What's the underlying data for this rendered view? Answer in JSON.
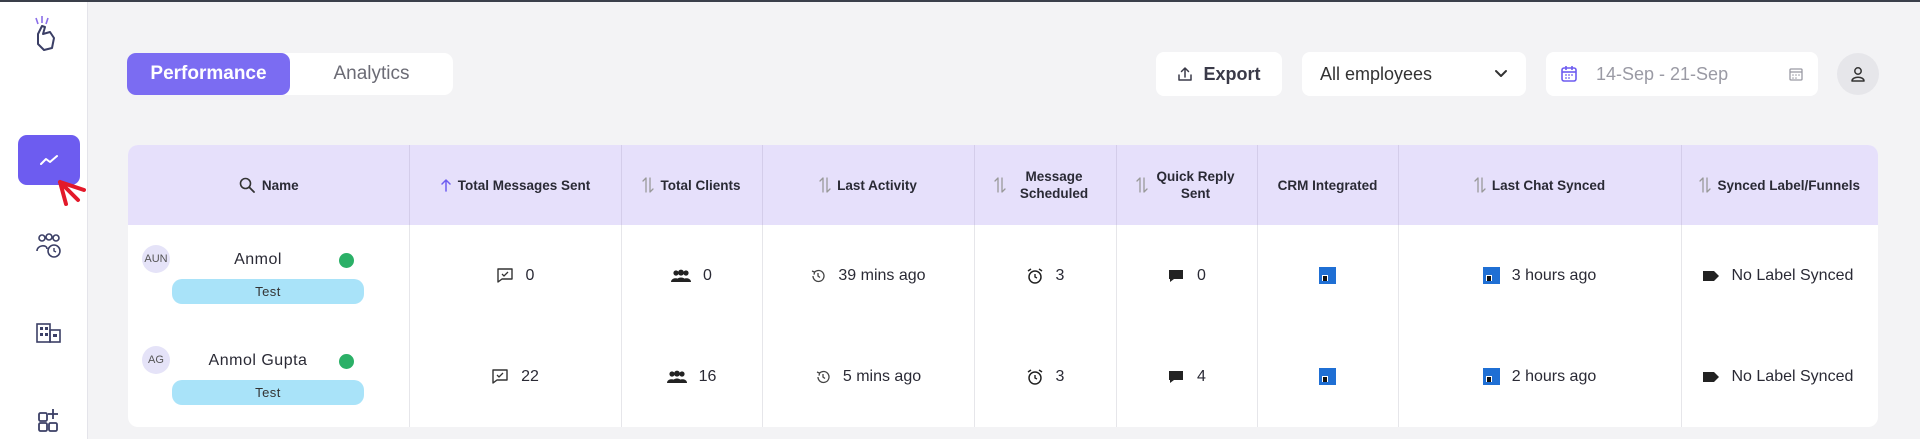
{
  "sidebar": {
    "items": [
      {
        "icon": "trend-chart-icon",
        "active": true
      },
      {
        "icon": "team-icon",
        "active": false
      },
      {
        "icon": "building-icon",
        "active": false
      },
      {
        "icon": "add-widget-icon",
        "active": false
      }
    ]
  },
  "tabs": [
    {
      "label": "Performance",
      "active": true
    },
    {
      "label": "Analytics",
      "active": false
    }
  ],
  "toolbar": {
    "export_label": "Export",
    "employee_filter": "All employees",
    "date_range": "14-Sep - 21-Sep"
  },
  "colors": {
    "accent": "#7b6cf2",
    "header_bg": "#e6e0fb",
    "tag_bg": "#a9e3f9",
    "verified": "#2bb067"
  },
  "table": {
    "columns": [
      "Name",
      "Total Messages Sent",
      "Total Clients",
      "Last Activity",
      "Message Scheduled",
      "Quick Reply Sent",
      "CRM Integrated",
      "Last Chat Synced",
      "Synced Label/Funnels"
    ],
    "rows": [
      {
        "initials": "AUN",
        "name": "Anmol",
        "tag": "Test",
        "messages_sent": "0",
        "clients": "0",
        "last_activity": "39 mins ago",
        "scheduled": "3",
        "quick_reply": "0",
        "last_chat_synced": "3 hours ago",
        "synced_label": "No Label Synced"
      },
      {
        "initials": "AG",
        "name": "Anmol Gupta",
        "tag": "Test",
        "messages_sent": "22",
        "clients": "16",
        "last_activity": "5 mins ago",
        "scheduled": "3",
        "quick_reply": "4",
        "last_chat_synced": "2 hours ago",
        "synced_label": "No Label Synced"
      }
    ]
  }
}
